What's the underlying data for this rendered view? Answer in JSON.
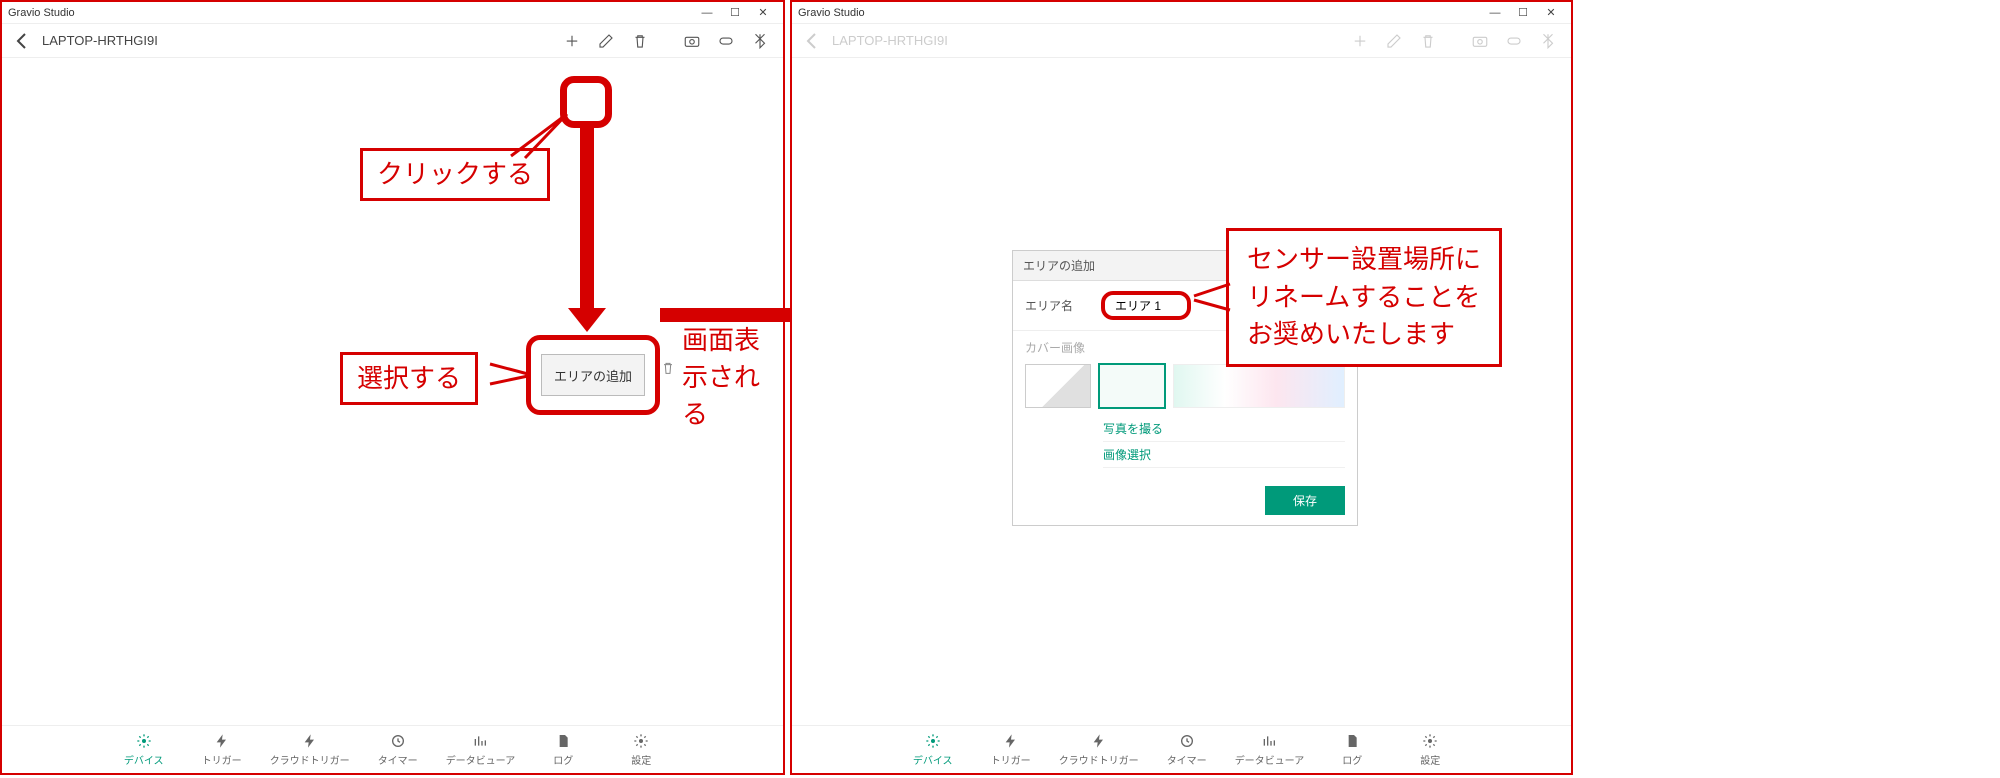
{
  "app_title": "Gravio Studio",
  "hostname": "LAPTOP-HRTHGI9I",
  "toolbar_icons": {
    "add": "plus-icon",
    "edit": "edit-icon",
    "delete": "trash-icon",
    "camera": "camera-icon",
    "device": "device-icon",
    "bluetooth": "bluetooth-icon"
  },
  "bottom_nav": [
    {
      "label": "デバイス",
      "active": true
    },
    {
      "label": "トリガー",
      "active": false
    },
    {
      "label": "クラウドトリガー",
      "active": false
    },
    {
      "label": "タイマー",
      "active": false
    },
    {
      "label": "データビューア",
      "active": false
    },
    {
      "label": "ログ",
      "active": false
    },
    {
      "label": "設定",
      "active": false
    }
  ],
  "annotations": {
    "click": "クリックする",
    "select": "選択する",
    "displayed": "画面表示される",
    "rename_l1": "センサー設置場所に",
    "rename_l2": "リネームすることを",
    "rename_l3": "お奨めいたします"
  },
  "add_area_button": "エリアの追加",
  "dialog": {
    "title": "エリアの追加",
    "area_label": "エリア名",
    "area_value": "エリア 1",
    "cover_label": "カバー画像",
    "take_photo": "写真を撮る",
    "choose_image": "画像選択",
    "save": "保存"
  }
}
